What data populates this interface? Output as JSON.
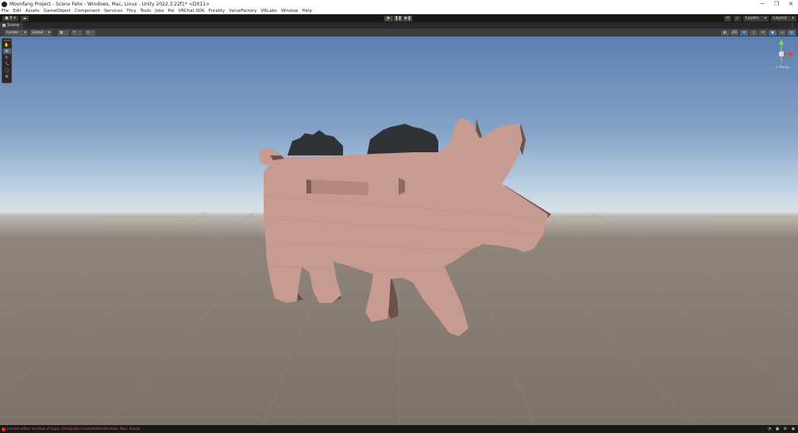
{
  "window": {
    "title": "Moonfang Project - Scene Felix - Windows, Mac, Linux - Unity 2022.3.22f1* <DX11>",
    "minimize_glyph": "─",
    "maximize_glyph": "❐",
    "close_glyph": "✕"
  },
  "menu": [
    "File",
    "Edit",
    "Assets",
    "GameObject",
    "Component",
    "Services",
    "Thry",
    "Tools",
    "Jobs",
    "Poi",
    "VRChat SDK",
    "Furality",
    "ValueFactory",
    "VRLabs",
    "Window",
    "Help"
  ],
  "toolbar": {
    "account_label": "● B ▾",
    "cloud_glyph": "☁",
    "play_glyph": "▶",
    "pause_glyph": "❚❚",
    "step_glyph": "▶❚",
    "history_glyph": "⟲",
    "search_glyph": "⌕",
    "layers_label": "Layers",
    "layout_label": "Layout",
    "dropdown_glyph": "▾"
  },
  "scene_tab": {
    "label": "Scene",
    "kebab": "⋮"
  },
  "scene_toolbar": {
    "pivot_label": "Center",
    "space_label": "Global",
    "dropdown_glyph": "▾"
  },
  "gizmo": {
    "label": "< Persp"
  },
  "status": {
    "message": "Invalid editor window of type: UnityEditor.GameEditorWindow, Mac: Game"
  },
  "colors": {
    "pig_body": "#c79a92",
    "pig_shadow": "#6d4f4b",
    "hair": "#2f3337",
    "error": "#e25a4a",
    "accent": "#4d6a8a"
  }
}
